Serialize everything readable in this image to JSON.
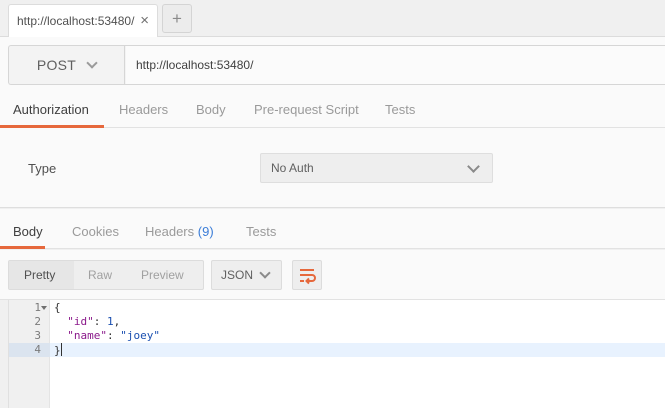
{
  "tab": {
    "title": "http://localhost:53480/",
    "close": "×",
    "new": "+"
  },
  "request": {
    "method": "POST",
    "url": "http://localhost:53480/",
    "tabs": [
      "Authorization",
      "Headers",
      "Body",
      "Pre-request Script",
      "Tests"
    ],
    "active_tab": "Authorization"
  },
  "auth": {
    "type_label": "Type",
    "type_value": "No Auth"
  },
  "response": {
    "tabs": {
      "body": "Body",
      "cookies": "Cookies",
      "headers": "Headers",
      "headers_count": "(9)",
      "tests": "Tests"
    },
    "active_tab": "Body",
    "formats": [
      "Pretty",
      "Raw",
      "Preview"
    ],
    "active_format": "Pretty",
    "language": "JSON",
    "lines": [
      {
        "num": "1",
        "open": "{"
      },
      {
        "num": "2",
        "key": "\"id\"",
        "sep": ": ",
        "value": "1",
        "tail": ","
      },
      {
        "num": "3",
        "key": "\"name\"",
        "sep": ": ",
        "value": "\"joey\"",
        "tail": ""
      },
      {
        "num": "4",
        "close": "}"
      }
    ]
  },
  "colors": {
    "accent": "#e6683c",
    "link_blue": "#3b7dd8"
  },
  "icons": [
    "close-icon",
    "plus-icon",
    "chevron-down-icon",
    "wrap-lines-icon",
    "fold-arrow-icon"
  ]
}
